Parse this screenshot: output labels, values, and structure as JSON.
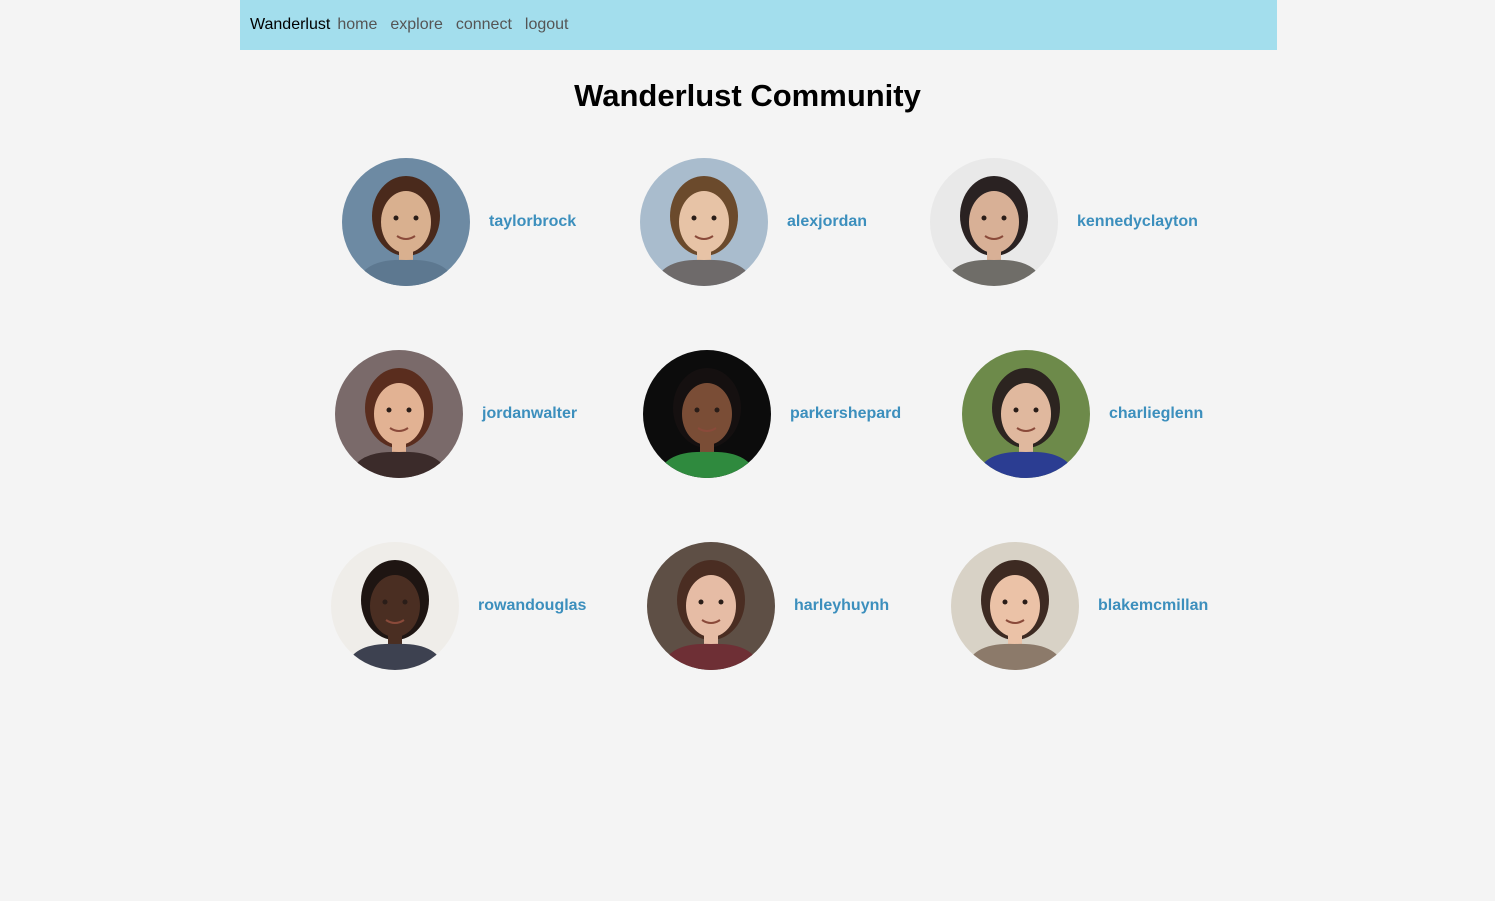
{
  "navbar": {
    "brand": "Wanderlust",
    "links": [
      "home",
      "explore",
      "connect",
      "logout"
    ]
  },
  "page": {
    "title": "Wanderlust Community"
  },
  "members": [
    {
      "username": "taylorbrock",
      "bg": "#6d8aa3",
      "skin": "#d9b08f",
      "hair": "#4a2a1c",
      "shirt": "#5d7890"
    },
    {
      "username": "alexjordan",
      "bg": "#a9bccd",
      "skin": "#e7c3a6",
      "hair": "#6b4a2c",
      "shirt": "#6e6a6a"
    },
    {
      "username": "kennedyclayton",
      "bg": "#e9e9e9",
      "skin": "#d8b096",
      "hair": "#2a2222",
      "shirt": "#6f6d68"
    },
    {
      "username": "jordanwalter",
      "bg": "#7a6a6a",
      "skin": "#e2b293",
      "hair": "#5a2d1e",
      "shirt": "#3b2b2a"
    },
    {
      "username": "parkershepard",
      "bg": "#0c0c0c",
      "skin": "#7a4d36",
      "hair": "#151010",
      "shirt": "#2f8a3e"
    },
    {
      "username": "charlieglenn",
      "bg": "#6d8a4a",
      "skin": "#e0b89e",
      "hair": "#2c2420",
      "shirt": "#2b3d92"
    },
    {
      "username": "rowandouglas",
      "bg": "#efede9",
      "skin": "#4a2e22",
      "hair": "#1e1512",
      "shirt": "#3d4150"
    },
    {
      "username": "harleyhuynh",
      "bg": "#5e4f45",
      "skin": "#e6bca5",
      "hair": "#4a2d22",
      "shirt": "#6e2f35"
    },
    {
      "username": "blakemcmillan",
      "bg": "#d8d2c6",
      "skin": "#ebc2a7",
      "hair": "#3d2a22",
      "shirt": "#8c7a6a"
    }
  ]
}
